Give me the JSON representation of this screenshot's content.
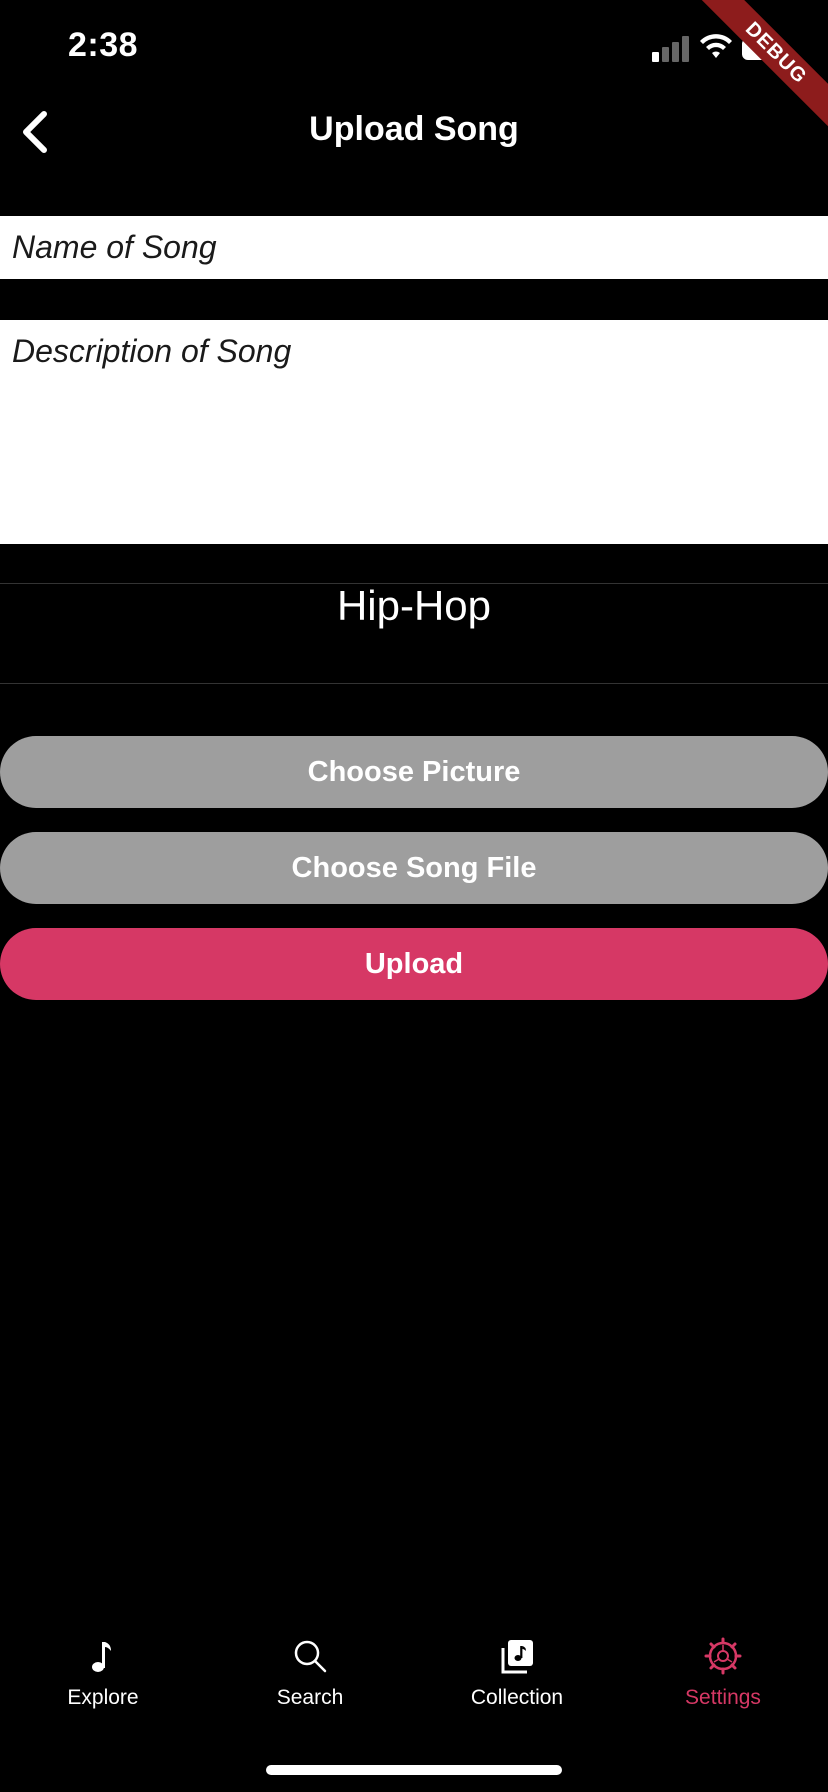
{
  "status_bar": {
    "time": "2:38"
  },
  "debug_banner": "DEBUG",
  "app_bar": {
    "title": "Upload Song"
  },
  "form": {
    "name_placeholder": "Name of Song",
    "description_placeholder": "Description of Song",
    "genre_selected": "Hip-Hop"
  },
  "buttons": {
    "choose_picture": "Choose Picture",
    "choose_song_file": "Choose Song File",
    "upload": "Upload"
  },
  "bottom_nav": {
    "items": [
      {
        "label": "Explore",
        "icon": "music-note-icon",
        "active": false
      },
      {
        "label": "Search",
        "icon": "search-icon",
        "active": false
      },
      {
        "label": "Collection",
        "icon": "collection-icon",
        "active": false
      },
      {
        "label": "Settings",
        "icon": "gear-icon",
        "active": true
      }
    ]
  },
  "colors": {
    "background": "#000000",
    "accent": "#d63865",
    "button_grey": "#9e9e9e",
    "debug_ribbon": "#8d1c1c"
  }
}
